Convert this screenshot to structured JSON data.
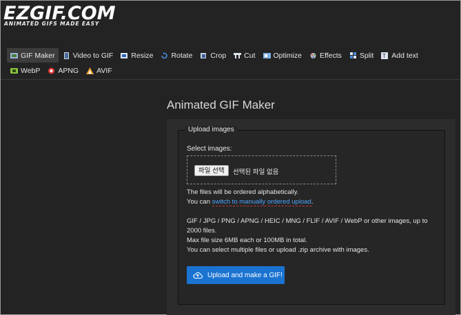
{
  "header": {
    "logo": "EZGIF.COM",
    "tagline": "ANIMATED GIFS MADE EASY"
  },
  "nav": {
    "items": [
      {
        "label": "GIF Maker",
        "icon": "gif-maker-icon",
        "active": true
      },
      {
        "label": "Video to GIF",
        "icon": "film-icon"
      },
      {
        "label": "Resize",
        "icon": "resize-icon"
      },
      {
        "label": "Rotate",
        "icon": "rotate-icon"
      },
      {
        "label": "Crop",
        "icon": "crop-icon"
      },
      {
        "label": "Cut",
        "icon": "cut-icon"
      },
      {
        "label": "Optimize",
        "icon": "optimize-icon"
      },
      {
        "label": "Effects",
        "icon": "effects-icon"
      },
      {
        "label": "Split",
        "icon": "split-icon"
      },
      {
        "label": "Add text",
        "icon": "text-icon"
      },
      {
        "label": "WebP",
        "icon": "webp-icon"
      },
      {
        "label": "APNG",
        "icon": "apng-icon"
      },
      {
        "label": "AVIF",
        "icon": "avif-icon"
      }
    ]
  },
  "main": {
    "title": "Animated GIF Maker",
    "legend": "Upload images",
    "select_label": "Select images:",
    "file_button": "파일 선택",
    "file_none": "선택된 파일 없음",
    "order_note": "The files will be ordered alphabetically.",
    "switch_prefix": "You can ",
    "switch_link": "switch to manually ordered upload",
    "switch_suffix": ".",
    "formats_line1": "GIF / JPG / PNG / APNG / HEIC / MNG / FLIF / AVIF / WebP or other images, up to",
    "formats_line2": "2000 files.",
    "size_note": "Max file size 6MB each or 100MB in total.",
    "multi_note": "You can select multiple files or upload .zip archive with images.",
    "upload_button": "Upload and make a GIF!"
  },
  "colors": {
    "background": "#232323",
    "accent": "#1a73d1",
    "link": "#4ba3ff"
  }
}
